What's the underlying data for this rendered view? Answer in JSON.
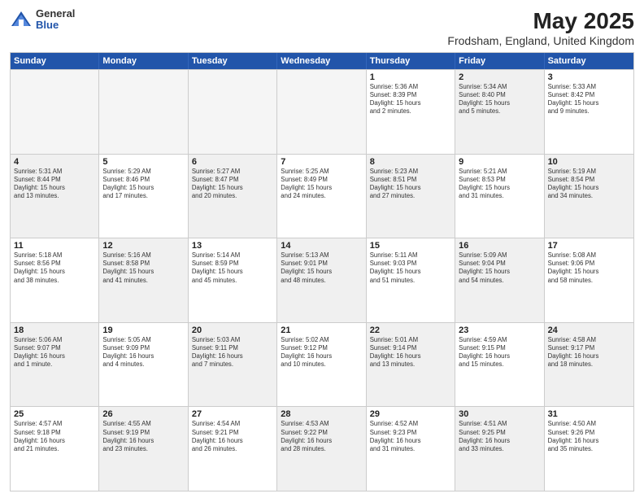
{
  "header": {
    "logo": {
      "general": "General",
      "blue": "Blue"
    },
    "title": "May 2025",
    "subtitle": "Frodsham, England, United Kingdom"
  },
  "calendar": {
    "days_of_week": [
      "Sunday",
      "Monday",
      "Tuesday",
      "Wednesday",
      "Thursday",
      "Friday",
      "Saturday"
    ],
    "rows": [
      [
        {
          "day": "",
          "empty": true
        },
        {
          "day": "",
          "empty": true
        },
        {
          "day": "",
          "empty": true
        },
        {
          "day": "",
          "empty": true
        },
        {
          "day": "1",
          "info": "Sunrise: 5:36 AM\nSunset: 8:39 PM\nDaylight: 15 hours\nand 2 minutes."
        },
        {
          "day": "2",
          "info": "Sunrise: 5:34 AM\nSunset: 8:40 PM\nDaylight: 15 hours\nand 5 minutes.",
          "shaded": true
        },
        {
          "day": "3",
          "info": "Sunrise: 5:33 AM\nSunset: 8:42 PM\nDaylight: 15 hours\nand 9 minutes."
        }
      ],
      [
        {
          "day": "4",
          "info": "Sunrise: 5:31 AM\nSunset: 8:44 PM\nDaylight: 15 hours\nand 13 minutes.",
          "shaded": true
        },
        {
          "day": "5",
          "info": "Sunrise: 5:29 AM\nSunset: 8:46 PM\nDaylight: 15 hours\nand 17 minutes."
        },
        {
          "day": "6",
          "info": "Sunrise: 5:27 AM\nSunset: 8:47 PM\nDaylight: 15 hours\nand 20 minutes.",
          "shaded": true
        },
        {
          "day": "7",
          "info": "Sunrise: 5:25 AM\nSunset: 8:49 PM\nDaylight: 15 hours\nand 24 minutes."
        },
        {
          "day": "8",
          "info": "Sunrise: 5:23 AM\nSunset: 8:51 PM\nDaylight: 15 hours\nand 27 minutes.",
          "shaded": true
        },
        {
          "day": "9",
          "info": "Sunrise: 5:21 AM\nSunset: 8:53 PM\nDaylight: 15 hours\nand 31 minutes."
        },
        {
          "day": "10",
          "info": "Sunrise: 5:19 AM\nSunset: 8:54 PM\nDaylight: 15 hours\nand 34 minutes.",
          "shaded": true
        }
      ],
      [
        {
          "day": "11",
          "info": "Sunrise: 5:18 AM\nSunset: 8:56 PM\nDaylight: 15 hours\nand 38 minutes."
        },
        {
          "day": "12",
          "info": "Sunrise: 5:16 AM\nSunset: 8:58 PM\nDaylight: 15 hours\nand 41 minutes.",
          "shaded": true
        },
        {
          "day": "13",
          "info": "Sunrise: 5:14 AM\nSunset: 8:59 PM\nDaylight: 15 hours\nand 45 minutes."
        },
        {
          "day": "14",
          "info": "Sunrise: 5:13 AM\nSunset: 9:01 PM\nDaylight: 15 hours\nand 48 minutes.",
          "shaded": true
        },
        {
          "day": "15",
          "info": "Sunrise: 5:11 AM\nSunset: 9:03 PM\nDaylight: 15 hours\nand 51 minutes."
        },
        {
          "day": "16",
          "info": "Sunrise: 5:09 AM\nSunset: 9:04 PM\nDaylight: 15 hours\nand 54 minutes.",
          "shaded": true
        },
        {
          "day": "17",
          "info": "Sunrise: 5:08 AM\nSunset: 9:06 PM\nDaylight: 15 hours\nand 58 minutes."
        }
      ],
      [
        {
          "day": "18",
          "info": "Sunrise: 5:06 AM\nSunset: 9:07 PM\nDaylight: 16 hours\nand 1 minute.",
          "shaded": true
        },
        {
          "day": "19",
          "info": "Sunrise: 5:05 AM\nSunset: 9:09 PM\nDaylight: 16 hours\nand 4 minutes."
        },
        {
          "day": "20",
          "info": "Sunrise: 5:03 AM\nSunset: 9:11 PM\nDaylight: 16 hours\nand 7 minutes.",
          "shaded": true
        },
        {
          "day": "21",
          "info": "Sunrise: 5:02 AM\nSunset: 9:12 PM\nDaylight: 16 hours\nand 10 minutes."
        },
        {
          "day": "22",
          "info": "Sunrise: 5:01 AM\nSunset: 9:14 PM\nDaylight: 16 hours\nand 13 minutes.",
          "shaded": true
        },
        {
          "day": "23",
          "info": "Sunrise: 4:59 AM\nSunset: 9:15 PM\nDaylight: 16 hours\nand 15 minutes."
        },
        {
          "day": "24",
          "info": "Sunrise: 4:58 AM\nSunset: 9:17 PM\nDaylight: 16 hours\nand 18 minutes.",
          "shaded": true
        }
      ],
      [
        {
          "day": "25",
          "info": "Sunrise: 4:57 AM\nSunset: 9:18 PM\nDaylight: 16 hours\nand 21 minutes."
        },
        {
          "day": "26",
          "info": "Sunrise: 4:55 AM\nSunset: 9:19 PM\nDaylight: 16 hours\nand 23 minutes.",
          "shaded": true
        },
        {
          "day": "27",
          "info": "Sunrise: 4:54 AM\nSunset: 9:21 PM\nDaylight: 16 hours\nand 26 minutes."
        },
        {
          "day": "28",
          "info": "Sunrise: 4:53 AM\nSunset: 9:22 PM\nDaylight: 16 hours\nand 28 minutes.",
          "shaded": true
        },
        {
          "day": "29",
          "info": "Sunrise: 4:52 AM\nSunset: 9:23 PM\nDaylight: 16 hours\nand 31 minutes."
        },
        {
          "day": "30",
          "info": "Sunrise: 4:51 AM\nSunset: 9:25 PM\nDaylight: 16 hours\nand 33 minutes.",
          "shaded": true
        },
        {
          "day": "31",
          "info": "Sunrise: 4:50 AM\nSunset: 9:26 PM\nDaylight: 16 hours\nand 35 minutes."
        }
      ]
    ]
  }
}
